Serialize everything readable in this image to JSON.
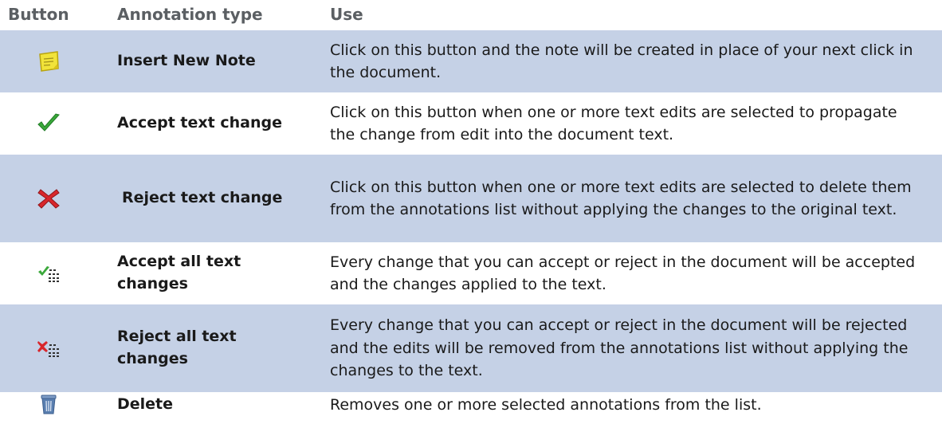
{
  "header": {
    "button": "Button",
    "annotation_type": "Annotation type",
    "use": "Use"
  },
  "rows": [
    {
      "icon": "note-icon",
      "type": "Insert New Note",
      "use": "Click on this button and the note will be created in place of your next click in the document."
    },
    {
      "icon": "checkmark-icon",
      "type": "Accept text change",
      "use": "Click on this button when one or more text edits are selected to propagate the change from edit into the document text."
    },
    {
      "icon": "red-x-icon",
      "type": "Reject text change",
      "use": "Click on this button when one or more text edits are selected to delete them from the annotations list without applying the changes to the original text."
    },
    {
      "icon": "accept-all-icon",
      "type": "Accept all text changes",
      "use": "Every change that you can accept or reject in the document will be accepted and the changes applied to the text."
    },
    {
      "icon": "reject-all-icon",
      "type": "Reject  all text changes",
      "use": "Every change that you can accept or reject in the document will be rejected and the edits will be removed from the annotations list without applying the changes to the text."
    },
    {
      "icon": "trash-icon",
      "type": "Delete",
      "use": "Removes one or more selected annotations from the list."
    }
  ],
  "colors": {
    "header_text": "#5b5f63",
    "row_shade": "#c5d1e6",
    "check_green": "#3aa83a",
    "x_red": "#d8262b",
    "note_yellow": "#f1e33a",
    "trash_blue": "#5a7fb0"
  }
}
